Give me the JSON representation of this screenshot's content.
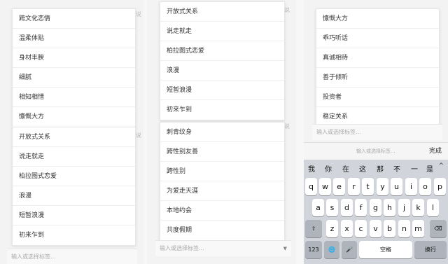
{
  "ghost_text": "有说",
  "input_placeholder": "输入或选择标签...",
  "panels": {
    "left": {
      "top_options": [
        "跨文化恋情",
        "温柔体贴",
        "身材丰腴",
        "细腻",
        "相知相惜",
        "慷慨大方"
      ],
      "bottom_options": [
        "开放式关系",
        "说走就走",
        "柏拉图式恋爱",
        "浪漫",
        "短暂浪漫",
        "初来乍到"
      ]
    },
    "mid": {
      "top_options": [
        "开放式关系",
        "说走就走",
        "柏拉图式恋爱",
        "浪漫",
        "短暂浪漫",
        "初来乍到"
      ],
      "bottom_options": [
        "刺青纹身",
        "跨性别友善",
        "跨性别",
        "为爱走天涯",
        "本地约会",
        "共度假期"
      ]
    },
    "right": {
      "options": [
        "慷慨大方",
        "乖巧听话",
        "真诚相待",
        "善于倾听",
        "投资者",
        "稳定关系"
      ]
    }
  },
  "keyboard": {
    "toolbar_placeholder": "输入或选择标签...",
    "done_label": "完成",
    "candidates": [
      "我",
      "你",
      "在",
      "这",
      "那",
      "不",
      "一",
      "是"
    ],
    "candidate_caret": "^",
    "row1": [
      "q",
      "w",
      "e",
      "r",
      "t",
      "y",
      "u",
      "i",
      "o",
      "p"
    ],
    "row2": [
      "a",
      "s",
      "d",
      "f",
      "g",
      "h",
      "j",
      "k",
      "l"
    ],
    "row3": [
      "z",
      "x",
      "c",
      "v",
      "b",
      "n",
      "m"
    ],
    "shift_label": "⇧",
    "delete_label": "⌫",
    "num_label": "123",
    "globe_label": "🌐",
    "mic_label": "🎤",
    "space_label": "空格",
    "return_label": "换行"
  }
}
